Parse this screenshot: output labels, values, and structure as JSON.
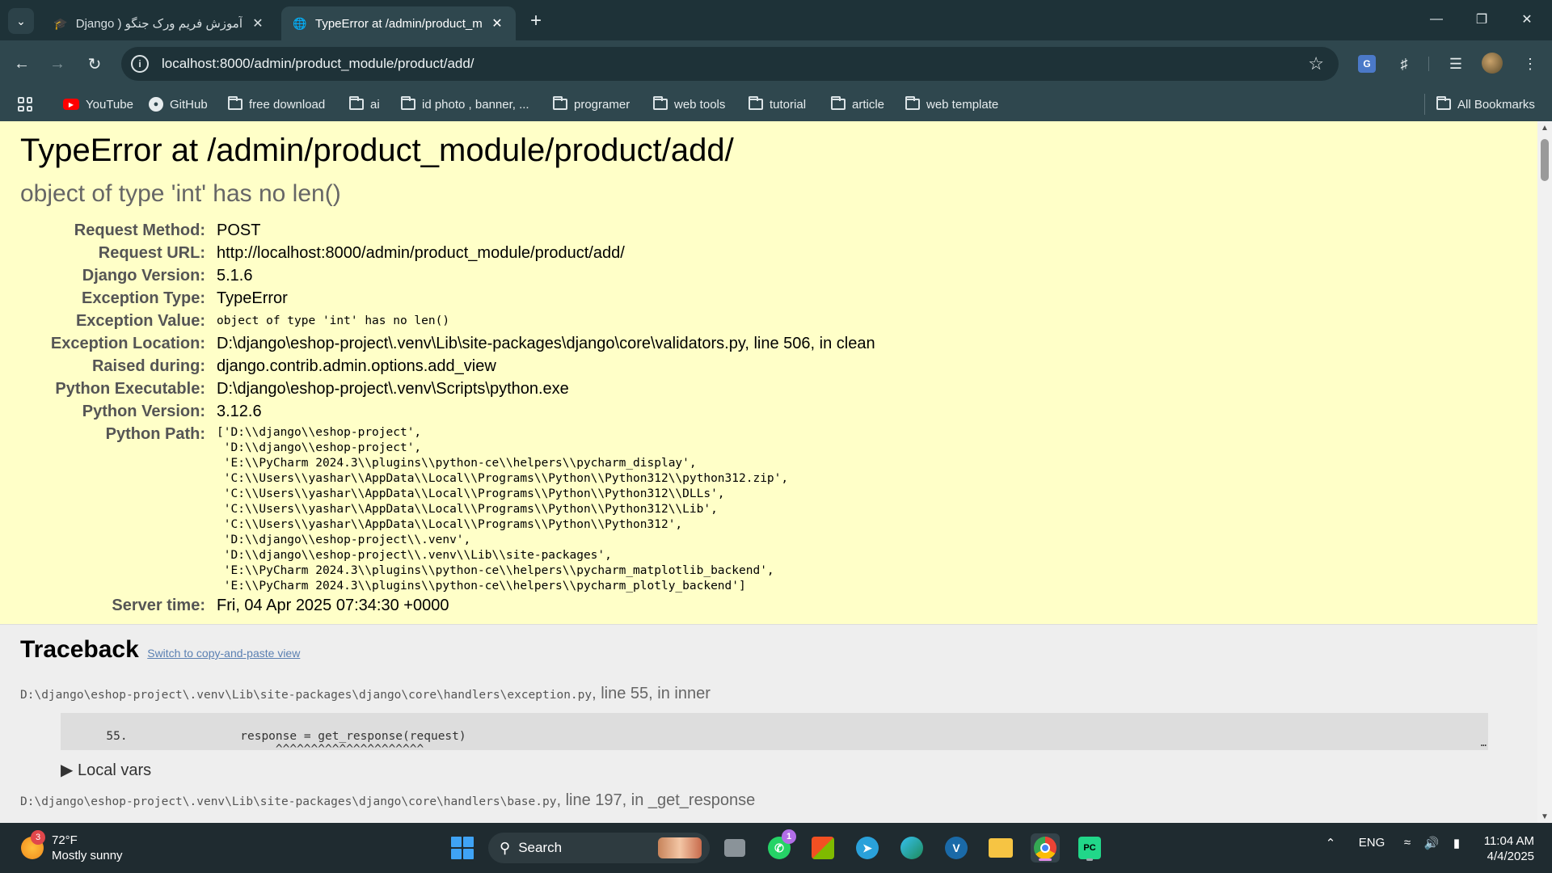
{
  "browser": {
    "tabs": [
      {
        "title": "آموزش فریم ورک جنگو ( Django",
        "active": false
      },
      {
        "title": "TypeError at /admin/product_m",
        "active": true
      }
    ],
    "url": "localhost:8000/admin/product_module/product/add/",
    "bookmarks": [
      "YouTube",
      "GitHub",
      "free download",
      "ai",
      "id photo , banner, ...",
      "programer",
      "web tools",
      "tutorial",
      "article",
      "web template"
    ],
    "all_bookmarks": "All Bookmarks"
  },
  "error": {
    "title": "TypeError at /admin/product_module/product/add/",
    "subtitle": "object of type 'int' has no len()",
    "meta": [
      {
        "key": "Request Method:",
        "value": "POST"
      },
      {
        "key": "Request URL:",
        "value": "http://localhost:8000/admin/product_module/product/add/"
      },
      {
        "key": "Django Version:",
        "value": "5.1.6"
      },
      {
        "key": "Exception Type:",
        "value": "TypeError"
      },
      {
        "key": "Exception Value:",
        "value": "object of type 'int' has no len()"
      },
      {
        "key": "Exception Location:",
        "value": "D:\\django\\eshop-project\\.venv\\Lib\\site-packages\\django\\core\\validators.py, line 506, in clean"
      },
      {
        "key": "Raised during:",
        "value": "django.contrib.admin.options.add_view"
      },
      {
        "key": "Python Executable:",
        "value": "D:\\django\\eshop-project\\.venv\\Scripts\\python.exe"
      },
      {
        "key": "Python Version:",
        "value": "3.12.6"
      },
      {
        "key": "Python Path:",
        "value": "['D:\\\\django\\\\eshop-project',\n 'D:\\\\django\\\\eshop-project',\n 'E:\\\\PyCharm 2024.3\\\\plugins\\\\python-ce\\\\helpers\\\\pycharm_display',\n 'C:\\\\Users\\\\yashar\\\\AppData\\\\Local\\\\Programs\\\\Python\\\\Python312\\\\python312.zip',\n 'C:\\\\Users\\\\yashar\\\\AppData\\\\Local\\\\Programs\\\\Python\\\\Python312\\\\DLLs',\n 'C:\\\\Users\\\\yashar\\\\AppData\\\\Local\\\\Programs\\\\Python\\\\Python312\\\\Lib',\n 'C:\\\\Users\\\\yashar\\\\AppData\\\\Local\\\\Programs\\\\Python\\\\Python312',\n 'D:\\\\django\\\\eshop-project\\\\.venv',\n 'D:\\\\django\\\\eshop-project\\\\.venv\\\\Lib\\\\site-packages',\n 'E:\\\\PyCharm 2024.3\\\\plugins\\\\python-ce\\\\helpers\\\\pycharm_matplotlib_backend',\n 'E:\\\\PyCharm 2024.3\\\\plugins\\\\python-ce\\\\helpers\\\\pycharm_plotly_backend']"
      },
      {
        "key": "Server time:",
        "value": "Fri, 04 Apr 2025 07:34:30 +0000"
      }
    ]
  },
  "traceback": {
    "heading": "Traceback",
    "switch_link": "Switch to copy-and-paste view",
    "frames": [
      {
        "path": "D:\\django\\eshop-project\\.venv\\Lib\\site-packages\\django\\core\\handlers\\exception.py",
        "info": ", line 55, in inner",
        "code": "55.                response = get_response(request)\n                              ^^^^^^^^^^^^^^^^^^^^^",
        "ellipsis": "…",
        "local_vars": "Local vars"
      },
      {
        "path": "D:\\django\\eshop-project\\.venv\\Lib\\site-packages\\django\\core\\handlers\\base.py",
        "info": ", line 197, in _get_response"
      }
    ]
  },
  "taskbar": {
    "weather_temp": "72°F",
    "weather_desc": "Mostly sunny",
    "weather_badge": "3",
    "search_label": "Search",
    "whatsapp_badge": "1",
    "language": "ENG",
    "time": "11:04 AM",
    "date": "4/4/2025"
  }
}
